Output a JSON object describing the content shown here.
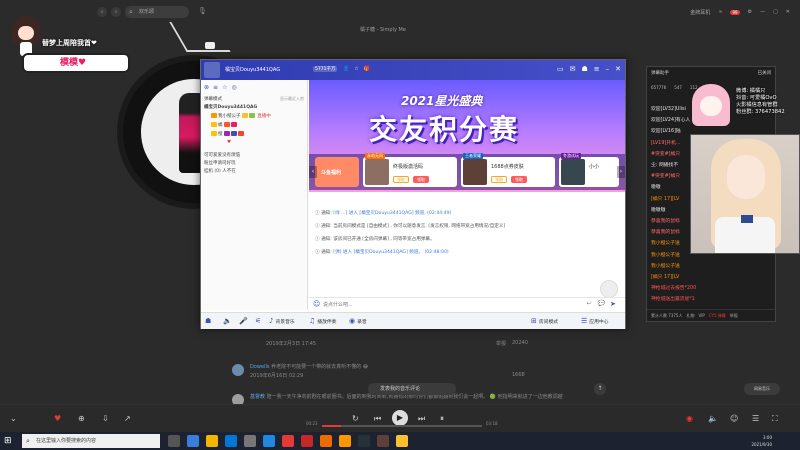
{
  "player": {
    "search_placeholder": "欢乐颂",
    "song_title": "橘子糖 - Simply Me",
    "top_right": [
      "金牌耳机",
      "∞"
    ],
    "badge_count": "99",
    "streamer_badge_text": "替梦上周陪我首❤",
    "streamer_badge_name": "模模♥"
  },
  "comments": {
    "line1_meta": "2019年2月3日 17:45",
    "line1_actions": "举报",
    "line1_likes": "20240",
    "row2_name": "Dowells",
    "row2_text": "养老院不可能要一个带的就去真听不懂的 😂",
    "row2_date": "2019年6月16日 02:29",
    "row2_likes": "1668",
    "row3_name": "基督教",
    "row3_text": "陪一我一天午净向前剧在眼前圈书。后面的到我时间到,到拥有的那时你们都瓣帕翻到我们会一起啊。 🟢 他指明来就进了一边他教调越",
    "share_label": "发表我的音乐评论",
    "side_label": "网易音乐"
  },
  "player_bar": {
    "time_elapsed": "00:23",
    "time_total": "03:18",
    "progress": 0.12
  },
  "taskbar": {
    "search_placeholder": "在这里输入你要搜索的内容",
    "time": "3:00",
    "date": "2021/9/30"
  },
  "douyu": {
    "header_name": "橘宝贝Douyu3441QAG",
    "header_fans": "5771千万",
    "left_tabs": [
      "⊗",
      "≡",
      "☆",
      "◎"
    ],
    "left_title": "弹幕模式",
    "left_title_right": "显示最近入房",
    "room_name": "橘宝贝Douyu3441QAG",
    "fans": [
      {
        "label": "我小橙公子",
        "extra": "直播中"
      },
      {
        "label": "橘"
      },
      {
        "label": "橙"
      },
      {
        "label": "♥"
      }
    ],
    "groups": [
      "可可爱爱没有烦恼",
      "粉丝申请司好玩",
      "挂机 (0) 人不在"
    ],
    "banner_sub": "2021星光盛典",
    "banner_title": "交友积分赛",
    "cards": [
      {
        "tag": "斗鱼福利",
        "title": "",
        "btn1": "",
        "btn2": ""
      },
      {
        "tag": "永劫无间",
        "title": "终极版激活码",
        "btn1": "领取",
        "btn2": "领取"
      },
      {
        "tag": "王者荣耀",
        "title": "1688点券皮肤",
        "btn1": "领取",
        "btn2": "领取"
      },
      {
        "tag": "冬游试玩",
        "title": "小小",
        "btn1": "",
        "btn2": ""
      }
    ],
    "messages": [
      {
        "prefix": "通知:",
        "text": "[绿 ...] 进入 [橘宝贝Douyu3441QAG] 频道, (02:44:49)"
      },
      {
        "prefix": "通知:",
        "text": "当前房间模式是 [自由模式] , 你可以随意发言. [发言权限, 网络带宽占用情况/自定义]"
      },
      {
        "prefix": "通知:",
        "text": "该房间已开通 [全房间弹幕] , 同等带宽占用弹幕。"
      },
      {
        "prefix": "通知:",
        "text": "[弹] 进入 [橘宝贝Douyu3441QAG] 频道。 (02:48:00)"
      }
    ],
    "input_placeholder": "说点什么吧...",
    "footer": [
      {
        "icon": "♪",
        "label": "背景音乐"
      },
      {
        "icon": "♫",
        "label": "播放伴奏"
      },
      {
        "icon": "◉",
        "label": "录音"
      },
      {
        "icon": "⊞",
        "label": "房间模式"
      },
      {
        "icon": "☰",
        "label": "应用中心"
      }
    ]
  },
  "chat": {
    "header_left": "弹幕助手",
    "header_right": "已关闭",
    "stats": [
      "657776",
      "547",
      "112",
      "0"
    ],
    "lines": [
      {
        "text": "欢迎[LV32]Ulisi",
        "color": "#e0e0e0"
      },
      {
        "text": "欢迎[LV24]有心人",
        "color": "#e0e0e0"
      },
      {
        "text": "欢迎[LV16]陆",
        "color": "#e0e0e0"
      },
      {
        "text": "[LV19]开机...",
        "color": "#ff6b6b"
      },
      {
        "text": "#突变#[橘只",
        "color": "#ff6b6b"
      },
      {
        "text": "尘: 网播找不",
        "color": "#e0e0e0"
      },
      {
        "text": "#突变#[橘只",
        "color": "#ff6b6b"
      },
      {
        "text": "嗷嗷",
        "color": "#e0e0e0"
      },
      {
        "text": "[橘只 17][LV",
        "color": "#ff8f00"
      },
      {
        "text": "嗷嗷嗷",
        "color": "#e0e0e0"
      },
      {
        "text": "恭喜我的鼠标",
        "color": "#ff6b6b"
      },
      {
        "text": "恭喜我的鼠标",
        "color": "#ff6b6b"
      },
      {
        "text": "我小橙公子送",
        "color": "#ff9800"
      },
      {
        "text": "我小橙公子送",
        "color": "#ff9800"
      },
      {
        "text": "我小橙公子送",
        "color": "#ff9800"
      },
      {
        "text": "[橘只 17][LV",
        "color": "#ff8f00"
      },
      {
        "text": "神枪城过去报告*200",
        "color": "#ff5252"
      },
      {
        "text": "神枪城送出露流星*1",
        "color": "#ff5252"
      }
    ],
    "footer": [
      "累计人数 7375人",
      "礼物",
      "VIP",
      "CY5 弹幕",
      "举报"
    ],
    "overlay_lines": [
      "微博: 橘橘只",
      "抖音: 可爱橘OvO",
      "火影橘信息有管群",
      "粉丝群: 376473842"
    ]
  },
  "colors": {
    "accent": "#3f51b5",
    "brand_red": "#e53935",
    "banner_purple": "#6a5cff"
  }
}
